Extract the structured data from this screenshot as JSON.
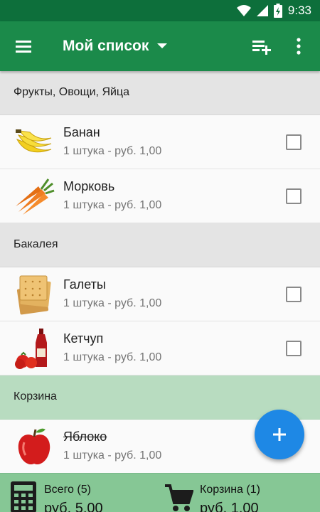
{
  "status_bar": {
    "time": "9:33"
  },
  "app_bar": {
    "title": "Мой список"
  },
  "sections": [
    {
      "title": "Фрукты, Овощи, Яйца"
    },
    {
      "title": "Бакалея"
    },
    {
      "title": "Корзина"
    }
  ],
  "items": [
    {
      "name": "Банан",
      "details": "1 штука - руб. 1,00",
      "checked": false
    },
    {
      "name": "Морковь",
      "details": "1 штука - руб. 1,00",
      "checked": false
    },
    {
      "name": "Галеты",
      "details": "1 штука - руб. 1,00",
      "checked": false
    },
    {
      "name": "Кетчуп",
      "details": "1 штука - руб. 1,00",
      "checked": false
    },
    {
      "name": "Яблоко",
      "details": "1 штука - руб. 1,00",
      "checked": true
    }
  ],
  "footer": {
    "total_label": "Всего (5)",
    "total_value": "руб. 5,00",
    "basket_label": "Корзина (1)",
    "basket_value": "руб. 1,00"
  },
  "colors": {
    "status_bar": "#0d6f3b",
    "app_bar": "#1b8a4a",
    "basket_header": "#b8dcc0",
    "bottom_bar": "#86c795",
    "fab": "#1e88e5"
  }
}
